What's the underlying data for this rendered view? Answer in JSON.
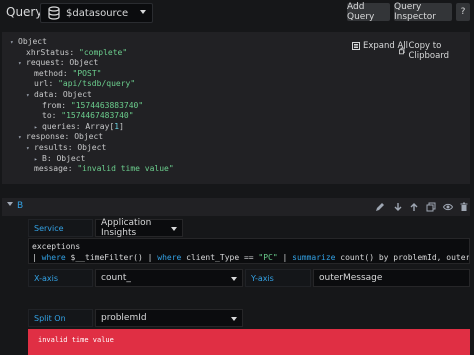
{
  "header": {
    "title": "Query",
    "datasource": "$datasource",
    "add_query": "Add Query",
    "query_inspector": "Query Inspector",
    "help": "?"
  },
  "inspector": {
    "expand_all": "Expand All",
    "copy": "Copy to Clipboard",
    "tree": [
      {
        "key": "Object",
        "type": "object"
      },
      {
        "key": "xhrStatus:",
        "val": "\"complete\"",
        "vt": "s"
      },
      {
        "key": "request:",
        "val": "Object",
        "vt": "k"
      },
      {
        "key": "method:",
        "val": "\"POST\"",
        "vt": "s"
      },
      {
        "key": "url:",
        "val": "\"api/tsdb/query\"",
        "vt": "s"
      },
      {
        "key": "data:",
        "val": "Object",
        "vt": "k"
      },
      {
        "key": "from:",
        "val": "\"1574463883740\"",
        "vt": "s"
      },
      {
        "key": "to:",
        "val": "\"1574467483740\"",
        "vt": "s"
      },
      {
        "key": "queries:",
        "val": "Array[1]",
        "vt": "arr"
      },
      {
        "key": "response:",
        "val": "Object",
        "vt": "k"
      },
      {
        "key": "results:",
        "val": "Object",
        "vt": "k"
      },
      {
        "key": "B:",
        "val": "Object",
        "vt": "k"
      },
      {
        "key": "message:",
        "val": "\"invalid time value\"",
        "vt": "s"
      }
    ]
  },
  "query": {
    "ref_id": "B",
    "service_label": "Service",
    "service_value": "Application Insights",
    "query_line1": "exceptions",
    "query_line2": "| where $__timeFilter() | where client_Type == \"PC\" | summarize count() by problemId, outerMessage",
    "xaxis_label": "X-axis",
    "xaxis_value": "count_",
    "yaxis_label": "Y-axis",
    "yaxis_value": "outerMessage",
    "split_label": "Split On",
    "split_value": "problemId",
    "error": "invalid time value"
  },
  "colors": {
    "accent": "#33a2e5",
    "string": "#6ccf8e",
    "error_bg": "#e02f44"
  }
}
